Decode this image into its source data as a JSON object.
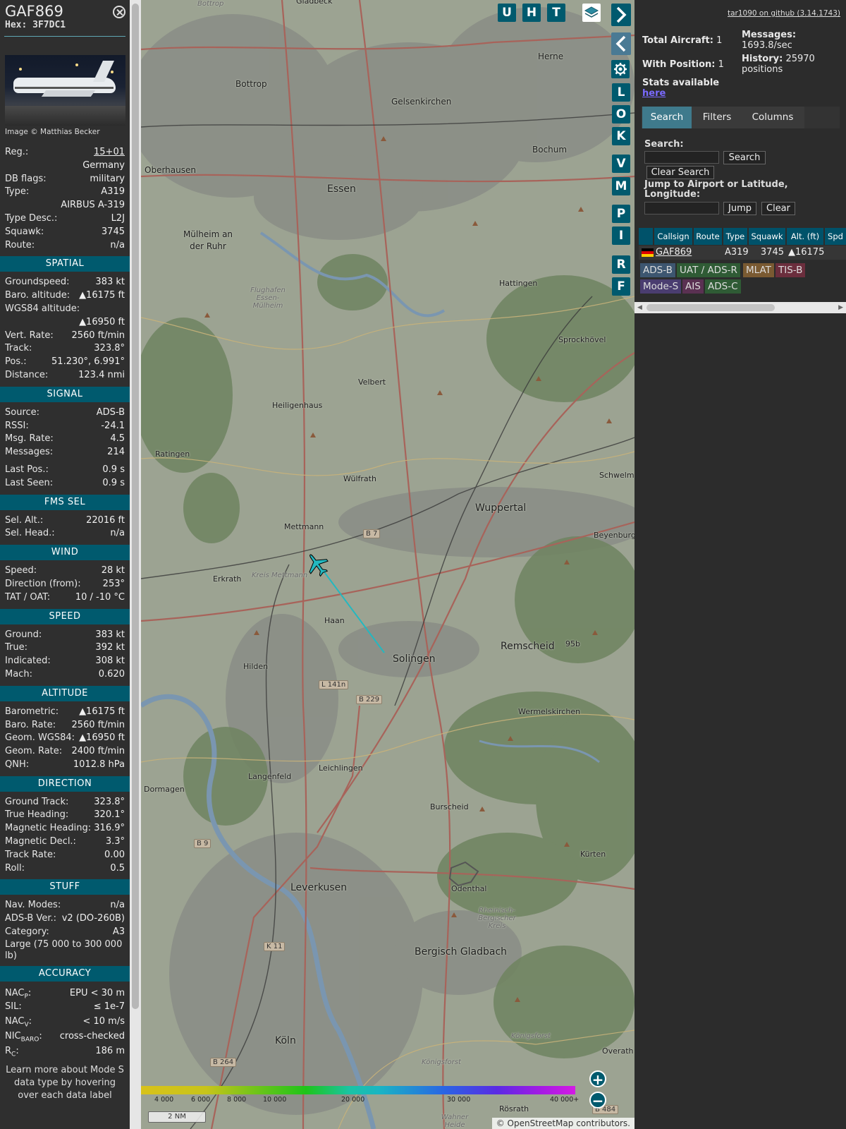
{
  "info": {
    "callsign": "GAF869",
    "hex_label": "Hex:",
    "hex": "3F7DC1",
    "photo_credit": "Image © Matthias Becker",
    "general": [
      {
        "label": "Reg.:",
        "value": "15+01"
      },
      {
        "label": "",
        "value": "Germany"
      },
      {
        "label": "DB flags:",
        "value": "military"
      },
      {
        "label": "Type:",
        "value": "A319"
      },
      {
        "label": "",
        "value": "AIRBUS A-319"
      },
      {
        "label": "Type Desc.:",
        "value": "L2J"
      },
      {
        "label": "Squawk:",
        "value": "3745"
      },
      {
        "label": "Route:",
        "value": "n/a"
      }
    ],
    "spatial_title": "SPATIAL",
    "spatial": [
      {
        "label": "Groundspeed:",
        "value": "383 kt"
      },
      {
        "label": "Baro. altitude:",
        "value": "▲16175 ft"
      },
      {
        "label": "WGS84 altitude:",
        "value": ""
      },
      {
        "label": "",
        "value": "▲16950 ft"
      },
      {
        "label": "Vert. Rate:",
        "value": "2560 ft/min"
      },
      {
        "label": "Track:",
        "value": "323.8°"
      },
      {
        "label": "Pos.:",
        "value": "51.230°, 6.991°"
      },
      {
        "label": "Distance:",
        "value": "123.4 nmi"
      }
    ],
    "signal_title": "SIGNAL",
    "signal": [
      {
        "label": "Source:",
        "value": "ADS-B"
      },
      {
        "label": "RSSI:",
        "value": "-24.1"
      },
      {
        "label": "Msg. Rate:",
        "value": "4.5"
      },
      {
        "label": "Messages:",
        "value": "214"
      }
    ],
    "signal2": [
      {
        "label": "Last Pos.:",
        "value": "0.9 s"
      },
      {
        "label": "Last Seen:",
        "value": "0.9 s"
      }
    ],
    "fms_title": "FMS SEL",
    "fms": [
      {
        "label": "Sel. Alt.:",
        "value": "22016 ft"
      },
      {
        "label": "Sel. Head.:",
        "value": "n/a"
      }
    ],
    "wind_title": "WIND",
    "wind": [
      {
        "label": "Speed:",
        "value": "28 kt"
      },
      {
        "label": "Direction (from):",
        "value": "253°"
      },
      {
        "label": "TAT / OAT:",
        "value": "10 / -10 °C"
      }
    ],
    "speed_title": "SPEED",
    "speed": [
      {
        "label": "Ground:",
        "value": "383 kt"
      },
      {
        "label": "True:",
        "value": "392 kt"
      },
      {
        "label": "Indicated:",
        "value": "308 kt"
      },
      {
        "label": "Mach:",
        "value": "0.620"
      }
    ],
    "altitude_title": "ALTITUDE",
    "altitude": [
      {
        "label": "Barometric:",
        "value": "▲16175 ft"
      },
      {
        "label": "Baro. Rate:",
        "value": "2560 ft/min"
      },
      {
        "label": "Geom. WGS84:",
        "value": "▲16950 ft"
      },
      {
        "label": "Geom. Rate:",
        "value": "2400 ft/min"
      },
      {
        "label": "QNH:",
        "value": "1012.8 hPa"
      }
    ],
    "direction_title": "DIRECTION",
    "direction": [
      {
        "label": "Ground Track:",
        "value": "323.8°"
      },
      {
        "label": "True Heading:",
        "value": "320.1°"
      },
      {
        "label": "Magnetic Heading:",
        "value": "316.9°"
      },
      {
        "label": "Magnetic Decl.:",
        "value": "3.3°"
      },
      {
        "label": "Track Rate:",
        "value": "0.00"
      },
      {
        "label": "Roll:",
        "value": "0.5"
      }
    ],
    "stuff_title": "STUFF",
    "stuff": [
      {
        "label": "Nav. Modes:",
        "value": "n/a"
      },
      {
        "label": "ADS-B Ver.:",
        "value": "v2 (DO-260B)"
      },
      {
        "label": "Category:",
        "value": "A3"
      }
    ],
    "category_desc": "Large (75 000 to 300 000 lb)",
    "accuracy_title": "ACCURACY",
    "accuracy": [
      {
        "label": "NAC",
        "sub": "P",
        "value": "EPU < 30 m"
      },
      {
        "label": "SIL:",
        "sub": "",
        "value": "≤ 1e-7"
      },
      {
        "label": "NAC",
        "sub": "V",
        "value": "< 10 m/s"
      },
      {
        "label": "NIC",
        "sub": "BARO",
        "value": "cross-checked"
      },
      {
        "label": "R",
        "sub": "C",
        "value": "186 m"
      }
    ],
    "learn_more": "Learn more about Mode S data type by hovering over each data label"
  },
  "map": {
    "buttons_top": [
      "U",
      "H",
      "T"
    ],
    "buttons_side": [
      "L",
      "O",
      "K",
      "V",
      "M",
      "P",
      "I",
      "R",
      "F"
    ],
    "places": [
      "Gladbeck",
      "Bottrop",
      "Herne",
      "Gelsenkirchen",
      "Bochum",
      "Oberhausen",
      "Essen",
      "Mülheim an der Ruhr",
      "Hattingen",
      "Sprockhövel",
      "Velbert",
      "Heiligenhaus",
      "Ratingen",
      "Wülfrath",
      "Wuppertal",
      "Mettmann",
      "Erkrath",
      "Haan",
      "Solingen",
      "Remscheid",
      "Hilden",
      "Wermelskirchen",
      "Langenfeld",
      "Leichlingen",
      "Dormagen",
      "Burscheid",
      "Kürten",
      "Odenthal",
      "Leverkusen",
      "Bergisch Gladbach",
      "Köln",
      "Overath",
      "Rösrath",
      "Schwelm",
      "Beyenburg",
      "Bottrop",
      "Flughafen Essen-Mülheim",
      "Kreis Mettmann",
      "Rheinisch-Bergischer Kreis",
      "Königsforst",
      "Wahner Heide",
      "Mülheim an der Ruhr"
    ],
    "roads": [
      "B 7",
      "L 141n",
      "B 229",
      "B 9",
      "K 11",
      "B 264",
      "B 484",
      "95b"
    ],
    "altitude_scale": [
      "4 000",
      "6 000",
      "8 000",
      "10 000",
      "20 000",
      "30 000",
      "40 000+"
    ],
    "scale": "2 NM",
    "attribution_prefix": "© ",
    "attribution_link": "OpenStreetMap",
    "attribution_suffix": " contributors.",
    "zoom_in": "+",
    "zoom_out": "−"
  },
  "sidebar": {
    "github": "tar1090 on github (3.14.1743)",
    "total_label": "Total Aircraft:",
    "total_value": "1",
    "with_pos_label": "With Position:",
    "with_pos_value": "1",
    "messages_label": "Messages:",
    "messages_value": "1693.8/sec",
    "history_label": "History:",
    "history_value": "25970 positions",
    "stats_label": "Stats available",
    "stats_link": "here",
    "tabs": [
      "Search",
      "Filters",
      "Columns"
    ],
    "search_label": "Search:",
    "search_button": "Search",
    "clear_search_button": "Clear Search",
    "jump_label": "Jump to Airport or Latitude, Longitude:",
    "jump_button": "Jump",
    "clear_button": "Clear",
    "table_headers": [
      "Callsign",
      "Route",
      "Type",
      "Squawk",
      "Alt. (ft)",
      "Spd"
    ],
    "table_row": {
      "callsign": "GAF869",
      "route": "",
      "type": "A319",
      "squawk": "3745",
      "alt": "▲16175"
    },
    "sources": [
      "ADS-B",
      "UAT / ADS-R",
      "MLAT",
      "TIS-B",
      "Mode-S",
      "AIS",
      "ADS-C"
    ],
    "source_colors": [
      "#3d5670",
      "#2f5b35",
      "#7a5a32",
      "#6b2e3d",
      "#4a3d70",
      "#5a3152",
      "#2f5b35"
    ]
  }
}
